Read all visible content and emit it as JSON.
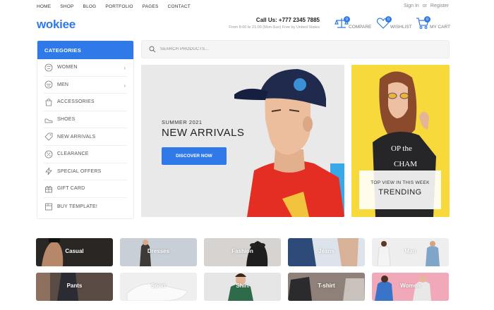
{
  "topnav": [
    "HOME",
    "SHOP",
    "BLOG",
    "PORTFOLIO",
    "PAGES",
    "CONTACT"
  ],
  "auth": {
    "signin": "Sign In",
    "or": "or",
    "register": "Register"
  },
  "logo": "wokiee",
  "contact": {
    "phone": "Call Us: +777 2345 7885",
    "hours": "From 8:00 to 21:00 (Mon-Sun) Free by United States"
  },
  "header_icons": [
    {
      "name": "compare",
      "label": "COMPARE",
      "count": "0"
    },
    {
      "name": "wishlist",
      "label": "WISHLIST",
      "count": "0"
    },
    {
      "name": "cart",
      "label": "MY CART",
      "count": "0"
    }
  ],
  "categories": {
    "title": "CATEGORIES",
    "items": [
      {
        "label": "WOMEN",
        "icon": "dress-icon",
        "has_sub": true,
        "chev": "›"
      },
      {
        "label": "MEN",
        "icon": "shirt-icon",
        "has_sub": true,
        "chev": "›"
      },
      {
        "label": "ACCESSORIES",
        "icon": "bag-icon",
        "has_sub": false
      },
      {
        "label": "SHOES",
        "icon": "shoe-icon",
        "has_sub": false
      },
      {
        "label": "NEW ARRIVALS",
        "icon": "tag-icon",
        "has_sub": false
      },
      {
        "label": "CLEARANCE",
        "icon": "percent-icon",
        "has_sub": false
      },
      {
        "label": "SPECIAL OFFERS",
        "icon": "lightning-icon",
        "has_sub": false
      },
      {
        "label": "GIFT CARD",
        "icon": "gift-icon",
        "has_sub": false
      },
      {
        "label": "BUY TEMPLATE!",
        "icon": "box-icon",
        "has_sub": false
      }
    ]
  },
  "search": {
    "placeholder": "SEARCH PRODUCTS..."
  },
  "hero": {
    "subtitle": "SUMMER 2021",
    "title": "NEW ARRIVALS",
    "button": "DISCOVER NOW"
  },
  "promo": {
    "subtitle": "TOP VIEW IN THIS WEEK",
    "title": "TRENDING"
  },
  "tiles": [
    {
      "label": "Casual",
      "bg": "#2a2624"
    },
    {
      "label": "Dresses",
      "bg": "#c9cfd6"
    },
    {
      "label": "Fashion",
      "bg": "#d6d3d1"
    },
    {
      "label": "Jeans",
      "bg": "#dde3ea"
    },
    {
      "label": "Man",
      "bg": "#eeeeee"
    },
    {
      "label": "Pants",
      "bg": "#5a4a44"
    },
    {
      "label": "Sport",
      "bg": "#efefef"
    },
    {
      "label": "Shirt",
      "bg": "#e6e6e6"
    },
    {
      "label": "T-shirt",
      "bg": "#8f8179"
    },
    {
      "label": "Women",
      "bg": "#f1a9b9"
    }
  ],
  "colors": {
    "accent": "#2f7ae8",
    "promo_bg": "#f7d93b"
  }
}
